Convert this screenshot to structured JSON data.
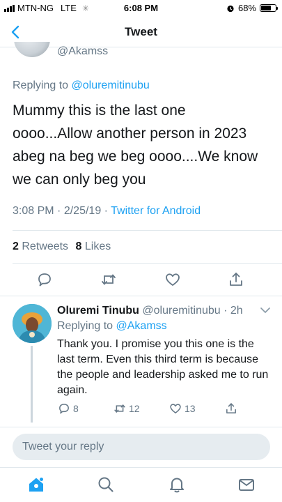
{
  "status_bar": {
    "carrier": "MTN-NG",
    "network": "LTE",
    "time": "6:08 PM",
    "battery_text": "68%",
    "battery_level": 0.68
  },
  "nav": {
    "title": "Tweet",
    "back_icon": "chevron-left-icon"
  },
  "main_tweet": {
    "author_handle": "@Akamss",
    "replying_prefix": "Replying to",
    "replying_to": "@oluremitinubu",
    "text_lines": [
      "Mummy this is the last one",
      "oooo...Allow another person in 2023",
      "abeg na beg we beg oooo....We know",
      "we can only beg you"
    ],
    "time": "3:08 PM",
    "date": "2/25/19",
    "source": "Twitter for Android",
    "retweets_count": "2",
    "retweets_label": "Retweets",
    "likes_count": "8",
    "likes_label": "Likes"
  },
  "reply_tweet": {
    "name": "Oluremi Tinubu",
    "handle": "@oluremitinubu",
    "age": "2h",
    "replying_prefix": "Replying to",
    "replying_to": "@Akamss",
    "text": "Thank you. I promise you this one is the last term. Even this third term is because the people and leadership asked me to run again.",
    "replies": "8",
    "retweets": "12",
    "likes": "13"
  },
  "composer": {
    "placeholder": "Tweet your reply"
  },
  "colors": {
    "accent": "#1da1f2",
    "muted": "#657786",
    "divider": "#e1e8ed"
  },
  "tabbar": {
    "items": [
      "home-icon",
      "search-icon",
      "notifications-icon",
      "messages-icon"
    ]
  }
}
